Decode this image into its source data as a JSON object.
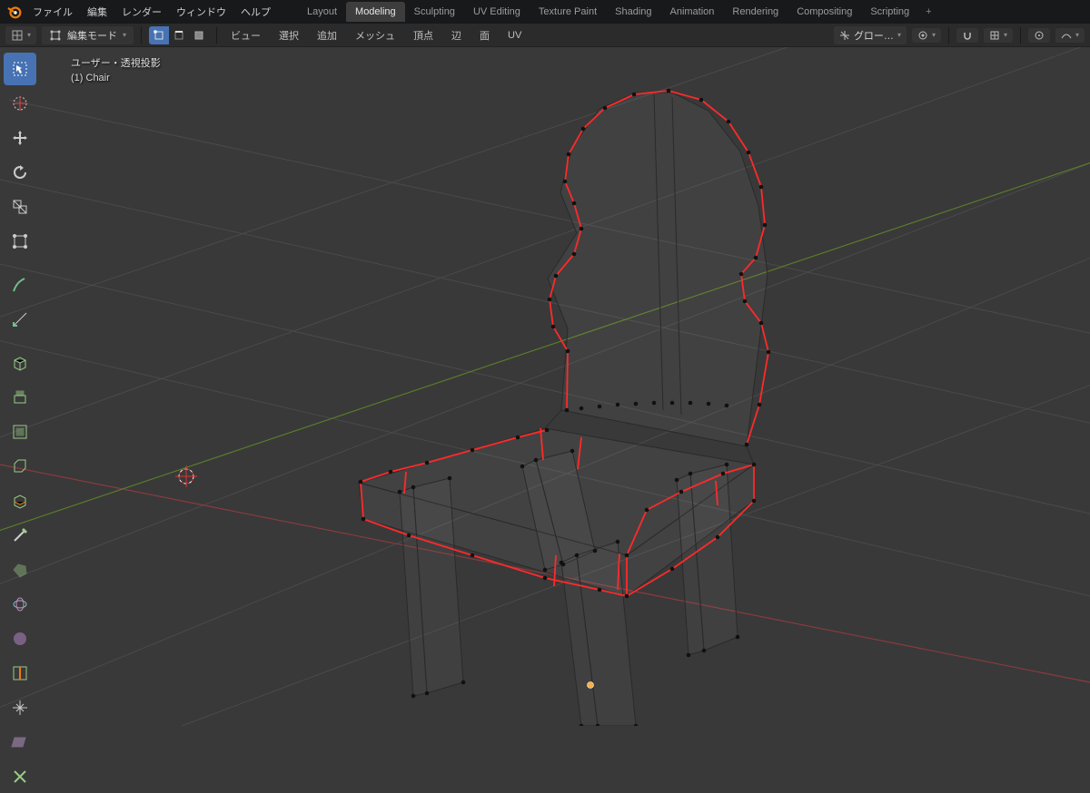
{
  "menu": {
    "items": [
      "ファイル",
      "編集",
      "レンダー",
      "ウィンドウ",
      "ヘルプ"
    ]
  },
  "workspaces": {
    "tabs": [
      "Layout",
      "Modeling",
      "Sculpting",
      "UV Editing",
      "Texture Paint",
      "Shading",
      "Animation",
      "Rendering",
      "Compositing",
      "Scripting"
    ],
    "active": 1,
    "add": "+"
  },
  "toolbar": {
    "mode": "編集モード",
    "labels": {
      "view": "ビュー",
      "select": "選択",
      "add": "追加",
      "mesh": "メッシュ",
      "vertex": "頂点",
      "edge": "辺",
      "face": "面",
      "uv": "UV"
    },
    "orient": "グロー…"
  },
  "overlay": {
    "line1": "ユーザー・透視投影",
    "line2": "(1) Chair"
  }
}
